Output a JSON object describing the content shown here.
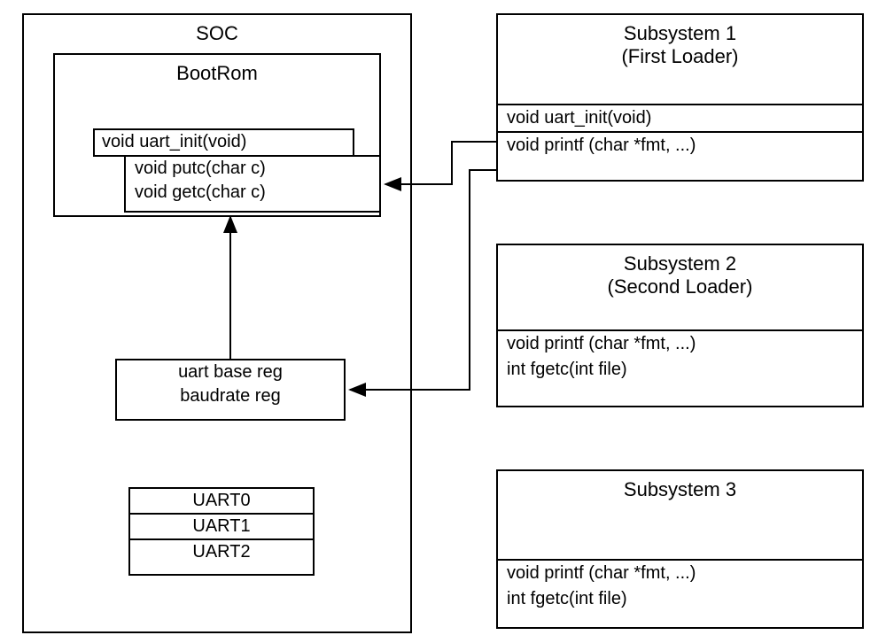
{
  "soc": {
    "title": "SOC",
    "bootrom": {
      "title": "BootRom",
      "uart_init": "void uart_init(void)",
      "putc": "void putc(char c)",
      "getc": "void getc(char c)"
    },
    "regs": {
      "line1": "uart base reg",
      "line2": "baudrate reg"
    },
    "uarts": {
      "u0": "UART0",
      "u1": "UART1",
      "u2": "UART2"
    }
  },
  "subsystem1": {
    "title1": "Subsystem 1",
    "title2": "(First Loader)",
    "func1": "void uart_init(void)",
    "func2": "void printf (char *fmt, ...)"
  },
  "subsystem2": {
    "title1": "Subsystem 2",
    "title2": "(Second Loader)",
    "func1": "void printf (char *fmt, ...)",
    "func2": "int fgetc(int file)"
  },
  "subsystem3": {
    "title": "Subsystem 3",
    "func1": "void printf (char *fmt, ...)",
    "func2": "int fgetc(int file)"
  }
}
